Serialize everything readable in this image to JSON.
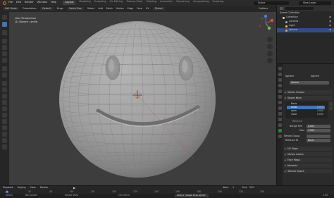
{
  "menu": {
    "items": [
      "File",
      "Edit",
      "Render",
      "Window",
      "Help"
    ],
    "workspace_tabs": [
      "Layout",
      "Modeling",
      "Sculpting",
      "UV Editing",
      "Texture Paint",
      "Shading",
      "Animation",
      "Rendering",
      "Compositing",
      "Scripting"
    ],
    "active_tab": "Layout",
    "scene": "Scene",
    "view_layer": "View Layer"
  },
  "viewport_header": {
    "mode": "Edit Mode",
    "orientation_label": "Orientation:",
    "orientation": "Default",
    "drag_label": "Drag:",
    "drag": "Select Box",
    "select": "Select",
    "add": "Add",
    "mesh": "Mesh",
    "vertex": "Vertex",
    "edge": "Edge",
    "face": "Face",
    "uv": "UV",
    "transform": "Global",
    "options": "Options"
  },
  "viewport": {
    "view_name": "User Perspective",
    "object_info": "(1) Sphere : smile",
    "bg_color": "#3d3d3d"
  },
  "outliner": {
    "title": "Scene Collection",
    "items": [
      {
        "label": "Collection",
        "color": "#d9d9d9",
        "selected": false
      },
      {
        "label": "Camera",
        "color": "#8da5d8",
        "selected": false
      },
      {
        "label": "Light",
        "color": "#e8c66b",
        "selected": false
      },
      {
        "label": "Sphere",
        "color": "#f29a3a",
        "selected": true
      }
    ]
  },
  "properties": {
    "object_name": "Sphere",
    "mesh_name": "Sphere",
    "data_field": "Sphere",
    "vertex_groups": "Vertex Groups",
    "shape_keys": "Shape Keys",
    "keys": [
      {
        "label": "Basis",
        "value": "",
        "selected": false
      },
      {
        "label": "smile",
        "value": "0.000",
        "selected": true
      },
      {
        "label": "open",
        "value": "0.000",
        "selected": false
      },
      {
        "label": "close",
        "value": "0.000",
        "selected": false
      }
    ],
    "relative_label": "Relative",
    "range_min_label": "Range Min",
    "range_min": "0.000",
    "max_label": "Max",
    "max": "1.000",
    "vertex_group_label": "Vertex Group",
    "relative_to_label": "Relative To",
    "relative_to": "Basis",
    "uv_maps": "UV Maps",
    "vertex_colors": "Vertex Colors",
    "face_maps": "Face Maps",
    "normals": "Normals",
    "texture_space": "Texture Space"
  },
  "timeline": {
    "items": [
      "Playback",
      "Keying",
      "View",
      "Marker"
    ],
    "ticks": [
      "0",
      "20",
      "40",
      "60",
      "80",
      "100",
      "120",
      "140",
      "160",
      "180",
      "200",
      "220",
      "240"
    ],
    "current_frame": "1",
    "start_label": "Start",
    "start": "1",
    "end_label": "End",
    "end": "250"
  },
  "status": {
    "select": "Select",
    "box_select": "Box Select",
    "rotate_view": "Rotate View",
    "call_menu": "Call Menu",
    "tooltip": "Select \"shape keys blend\"",
    "version": "2.90"
  },
  "icons": [
    "blender-logo-icon",
    "cursor-icon",
    "move-icon",
    "rotate-icon",
    "scale-icon",
    "transform-icon",
    "annotate-icon",
    "measure-icon",
    "extrude-icon",
    "inset-icon",
    "bevel-icon",
    "loopcut-icon",
    "knife-icon",
    "polybuild-icon",
    "spin-icon",
    "smooth-icon",
    "shear-icon",
    "rip-icon",
    "zoom-icon",
    "hand-icon",
    "camera-icon",
    "grid-icon",
    "eye-icon",
    "mesh-data-icon",
    "play-icon"
  ]
}
